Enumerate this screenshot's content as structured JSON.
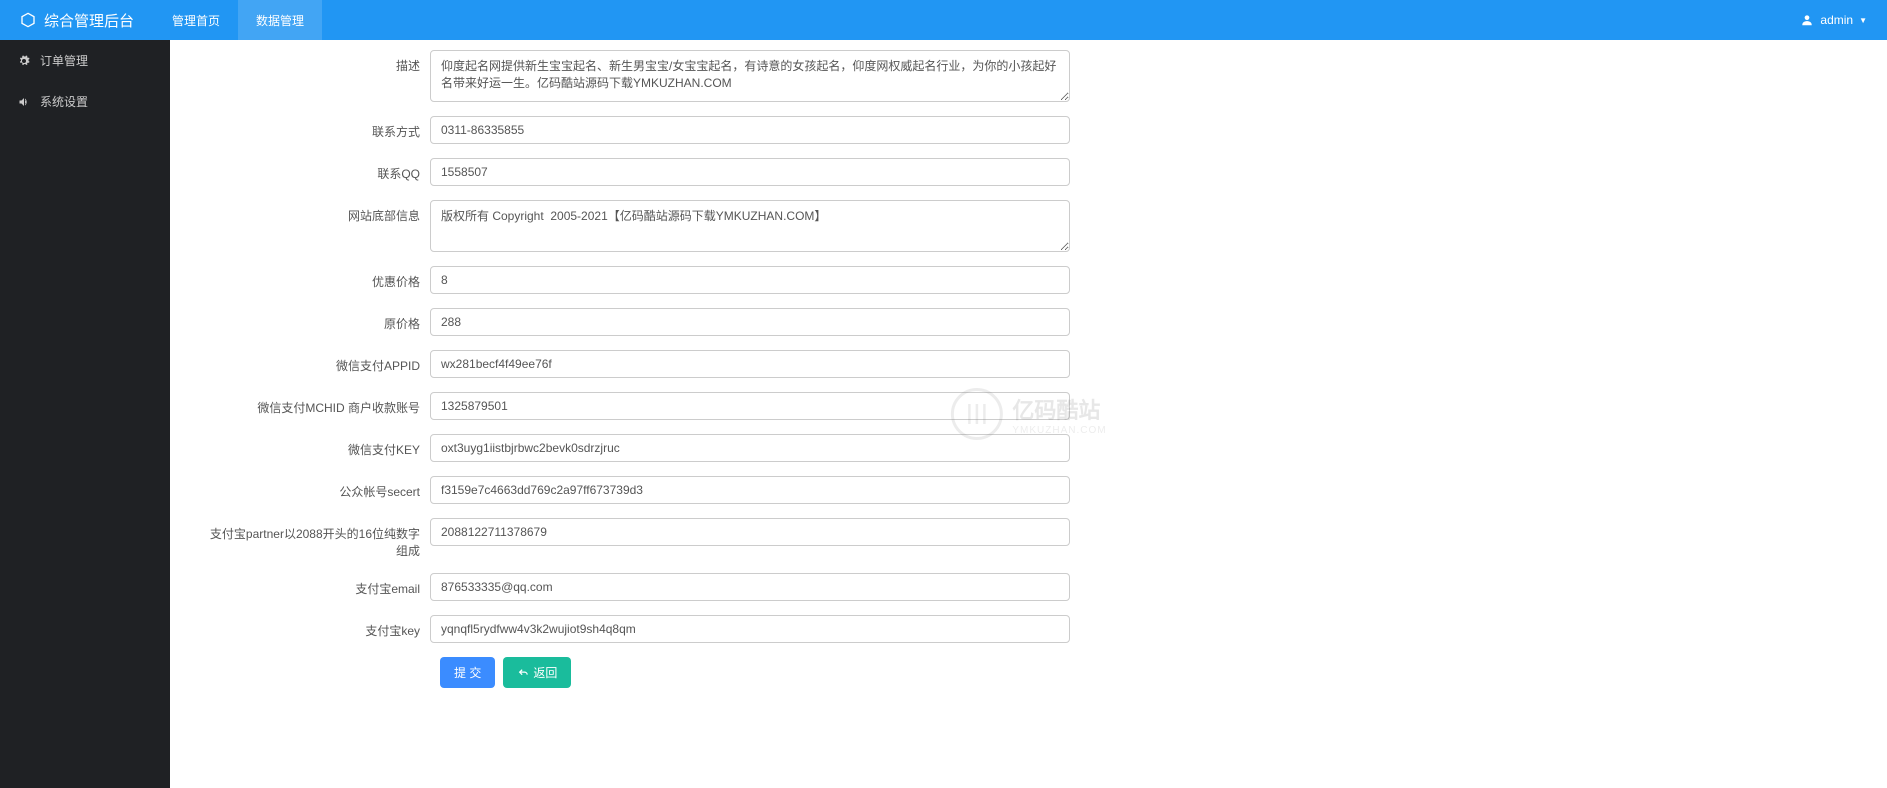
{
  "header": {
    "title": "综合管理后台",
    "nav": [
      {
        "label": "管理首页",
        "active": false
      },
      {
        "label": "数据管理",
        "active": true
      }
    ],
    "user": "admin"
  },
  "sidebar": {
    "items": [
      {
        "label": "订单管理",
        "icon": "gear"
      },
      {
        "label": "系统设置",
        "icon": "volume"
      }
    ]
  },
  "form": {
    "description": {
      "label": "描述",
      "value": "仰度起名网提供新生宝宝起名、新生男宝宝/女宝宝起名，有诗意的女孩起名，仰度网权威起名行业，为你的小孩起好名带来好运一生。亿码酷站源码下载YMKUZHAN.COM"
    },
    "contact": {
      "label": "联系方式",
      "value": "0311-86335855"
    },
    "qq": {
      "label": "联系QQ",
      "value": "1558507"
    },
    "footer": {
      "label": "网站底部信息",
      "value": "版权所有 Copyright  2005-2021【亿码酷站源码下载YMKUZHAN.COM】"
    },
    "discountPrice": {
      "label": "优惠价格",
      "value": "8"
    },
    "originalPrice": {
      "label": "原价格",
      "value": "288"
    },
    "wxAppId": {
      "label": "微信支付APPID",
      "value": "wx281becf4f49ee76f"
    },
    "wxMchId": {
      "label": "微信支付MCHID 商户收款账号",
      "value": "1325879501"
    },
    "wxKey": {
      "label": "微信支付KEY",
      "value": "oxt3uyg1iistbjrbwc2bevk0sdrzjruc"
    },
    "wxSecret": {
      "label": "公众帐号secert",
      "value": "f3159e7c4663dd769c2a97ff673739d3"
    },
    "alipayPartner": {
      "label": "支付宝partner以2088开头的16位纯数字组成",
      "value": "2088122711378679"
    },
    "alipayEmail": {
      "label": "支付宝email",
      "value": "876533335@qq.com"
    },
    "alipayKey": {
      "label": "支付宝key",
      "value": "yqnqfl5rydfww4v3k2wujiot9sh4q8qm"
    }
  },
  "actions": {
    "submit": "提 交",
    "back": "返回"
  },
  "watermark": {
    "cn": "亿码酷站",
    "en": "YMKUZHAN.COM"
  }
}
